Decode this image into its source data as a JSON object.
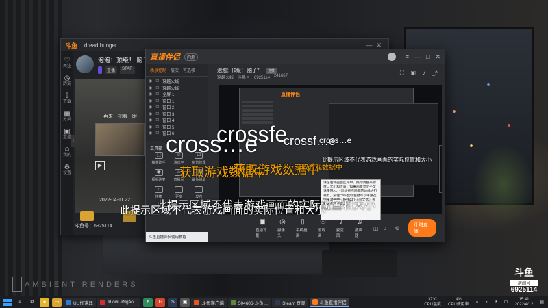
{
  "back_window": {
    "logo": "斗鱼",
    "tab_title": "dread hunger",
    "room_title": "泡泡：顶级！ 脑子…",
    "tags": [
      "",
      "直播",
      "STAR"
    ],
    "rail": [
      "关注",
      "历史",
      "下载",
      "分类",
      "直播",
      "我的",
      "设置"
    ],
    "video_caption": "再来一把看一眼",
    "video_date": "2022-04-11 22",
    "room_id": "斗鱼号：6925114"
  },
  "main_window": {
    "logo": "直播伴侣",
    "beta_badge": "内测",
    "tabs": [
      "场景控制",
      "层次",
      "可选模"
    ],
    "scenes": [
      {
        "name": "穿越火线"
      },
      {
        "name": "穿越火线"
      },
      {
        "name": "全屏 1"
      },
      {
        "name": "窗口 1"
      },
      {
        "name": "窗口 2"
      },
      {
        "name": "窗口 3"
      },
      {
        "name": "窗口 4"
      },
      {
        "name": "窗口 5"
      },
      {
        "name": "窗口 6"
      }
    ],
    "tools_label": "工具箱",
    "tools": [
      {
        "label": "抽奖助手",
        "icon": "⬚"
      },
      {
        "label": "游戏平",
        "icon": "☺"
      },
      {
        "label": "房管管理",
        "icon": "☑"
      },
      {
        "label": "视频连麦",
        "icon": "◉"
      },
      {
        "label": "直播间",
        "icon": "⌂"
      },
      {
        "label": "鲨鱼弹幕",
        "icon": "▤"
      },
      {
        "label": "快捷",
        "icon": "↑"
      },
      {
        "label": "更多",
        "icon": "…"
      },
      {
        "label": "发布",
        "icon": "↑"
      }
    ],
    "status_bar": "斗鱼直播伴侣使用教程",
    "stage_title": "泡泡：顶级！ 脑子？",
    "stage_tag": "竞技",
    "stage_sub": [
      "穿越火线",
      "斗鱼号：6925114",
      "241667"
    ],
    "tooltip": "请在右侧画面区域中，拖动调整来源窗口大小和位置，如果画面显示不全请使用ALT+鼠标拖拽画面的边缘进行裁剪。按住Ctrl+鼠标左键可以单独选中来源画面，按住Ctrl+A可全选，查看更多快捷键。",
    "bottom_buttons": [
      {
        "label": "直播背景",
        "icon": "▣"
      },
      {
        "label": "摄像头",
        "icon": "◎"
      },
      {
        "label": "手机投屏",
        "icon": "▯"
      },
      {
        "label": "游戏画",
        "icon": "☉"
      },
      {
        "label": "麦克风",
        "icon": "♪"
      },
      {
        "label": "扬声器",
        "icon": "♫"
      }
    ],
    "go_live": "开始直播"
  },
  "overlay": {
    "cross_big": "crossfe",
    "cross_mid": "cross…e",
    "cross_small": "crossf…e",
    "get_data": "获取游戏数据中",
    "tip_text": "此提示区域不代表游戏画面的实际位置和大小"
  },
  "corner": {
    "logo": "斗鱼",
    "label": "房间号",
    "room_no": "6925114"
  },
  "desktop_watermark": "AMBIENT RENDERS",
  "taskbar": {
    "tasks": [
      {
        "label": "UU加速器",
        "color": "#2b7bd8"
      },
      {
        "label": "#Lovii  #Ngảo…",
        "color": "#cc2e35"
      },
      {
        "label": "斗鱼客户端",
        "color": "#e7561d"
      },
      {
        "label": "504606·斗鱼…",
        "color": "#5a8a3a"
      },
      {
        "label": "Steam 登录",
        "color": "#2d3a52"
      },
      {
        "label": "斗鱼直播伴侣",
        "color": "#ff7a18"
      }
    ],
    "temp": "37°C",
    "temp_label": "CPU温度",
    "cpu": "4%",
    "cpu_label": "CPU使用率",
    "time": "15:41",
    "date": "2022/4/12"
  }
}
